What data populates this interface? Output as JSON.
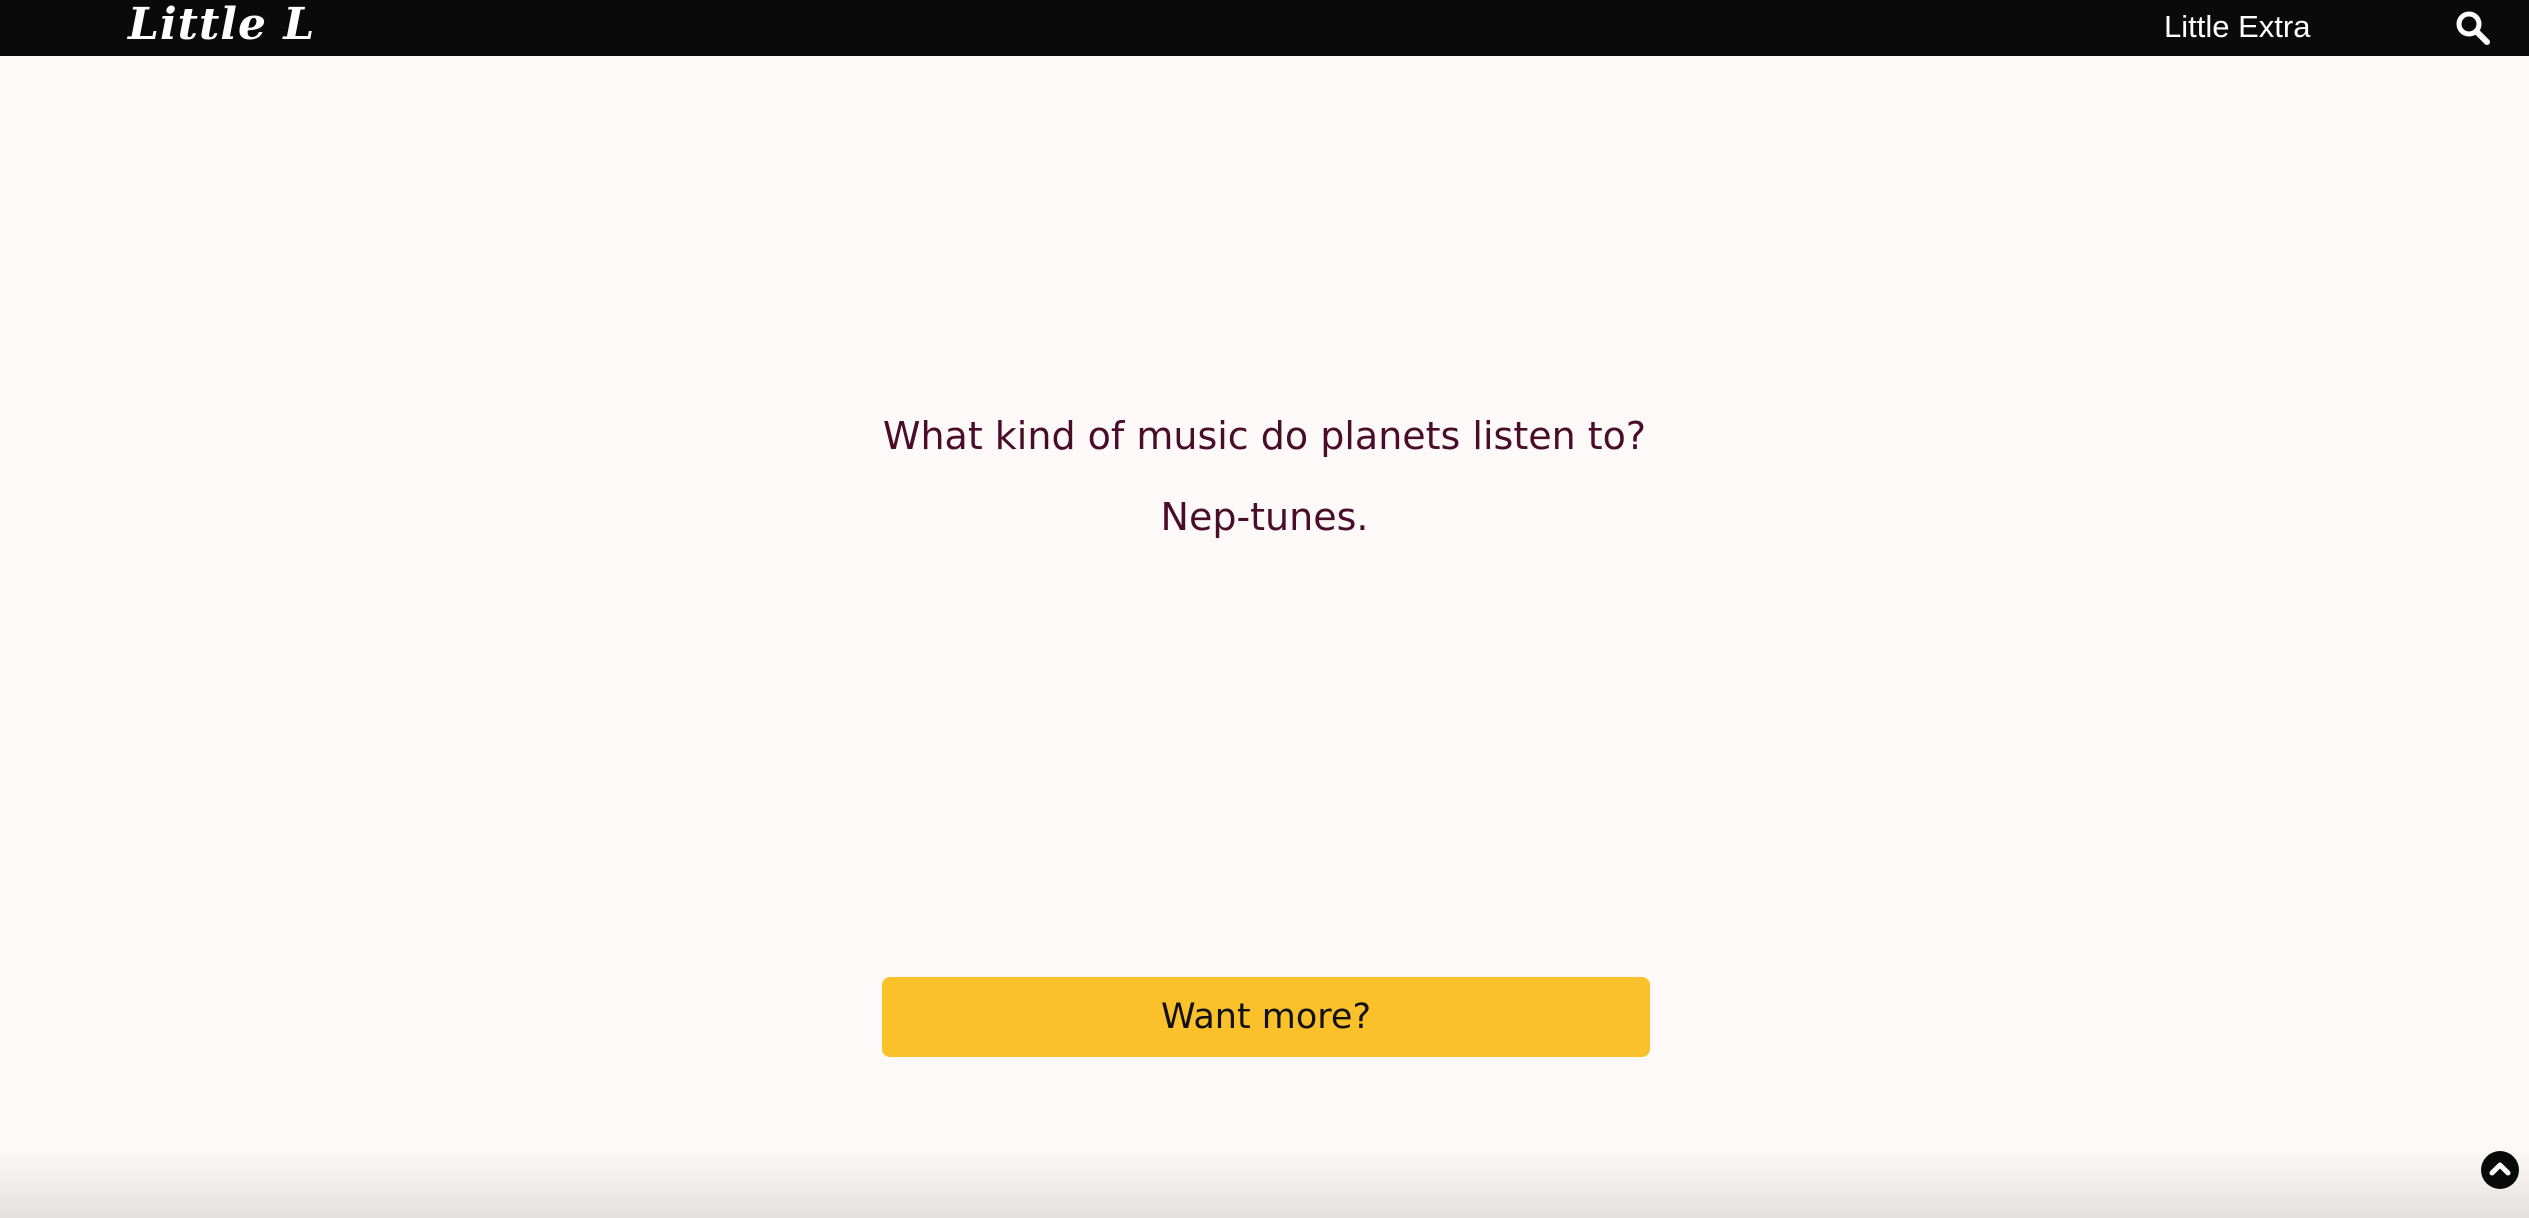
{
  "header": {
    "logo_text": "Little L",
    "nav_link": "Little Extra",
    "search_icon": "search-icon"
  },
  "joke": {
    "question": "What kind of music do planets listen to?",
    "answer": "Nep-tunes."
  },
  "cta": {
    "label": "Want more?"
  },
  "footer": {
    "scroll_top_icon": "chevron-up-circle-icon"
  },
  "colors": {
    "header_bg": "#0a0a0a",
    "page_bg": "#fdf9f8",
    "joke_text": "#4a0d28",
    "button_bg": "#fbc12a",
    "button_text": "#111111"
  }
}
